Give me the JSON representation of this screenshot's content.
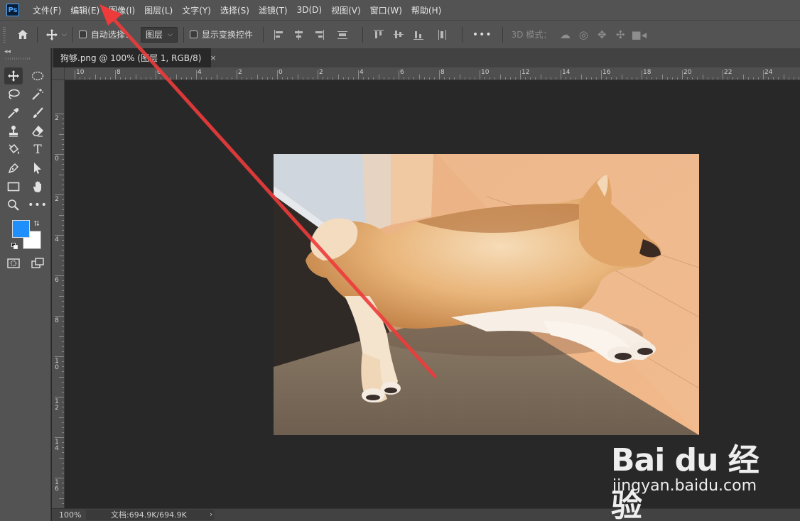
{
  "app": {
    "logo_text": "Ps"
  },
  "menu": [
    "文件(F)",
    "编辑(E)",
    "图像(I)",
    "图层(L)",
    "文字(Y)",
    "选择(S)",
    "滤镜(T)",
    "3D(D)",
    "视图(V)",
    "窗口(W)",
    "帮助(H)"
  ],
  "options": {
    "auto_select_label": "自动选择：",
    "layer_select_value": "图层",
    "show_transform_label": "显示变换控件",
    "more_label": "•••",
    "mode_3d_label": "3D 模式："
  },
  "document": {
    "tab_title": "狗够.png @ 100% (图层 1, RGB/8)",
    "tab_close": "×"
  },
  "rulers": {
    "top_labels": [
      "10",
      "8",
      "6",
      "4",
      "2",
      "0",
      "2",
      "4",
      "6",
      "8",
      "10",
      "12",
      "14",
      "16",
      "18",
      "20",
      "22",
      "24"
    ],
    "left_labels": [
      "2",
      "0",
      "2",
      "4",
      "6",
      "8",
      "10",
      "12",
      "14",
      "16"
    ]
  },
  "status": {
    "zoom": "100%",
    "doc_info": "文档:694.9K/694.9K",
    "chevron": "›"
  },
  "colors": {
    "foreground": "#1e8ffb",
    "background": "#ffffff",
    "arrow": "#ee3b3b"
  },
  "watermark": {
    "brand": "Bai du 经验",
    "url": "jingyan.baidu.com"
  }
}
